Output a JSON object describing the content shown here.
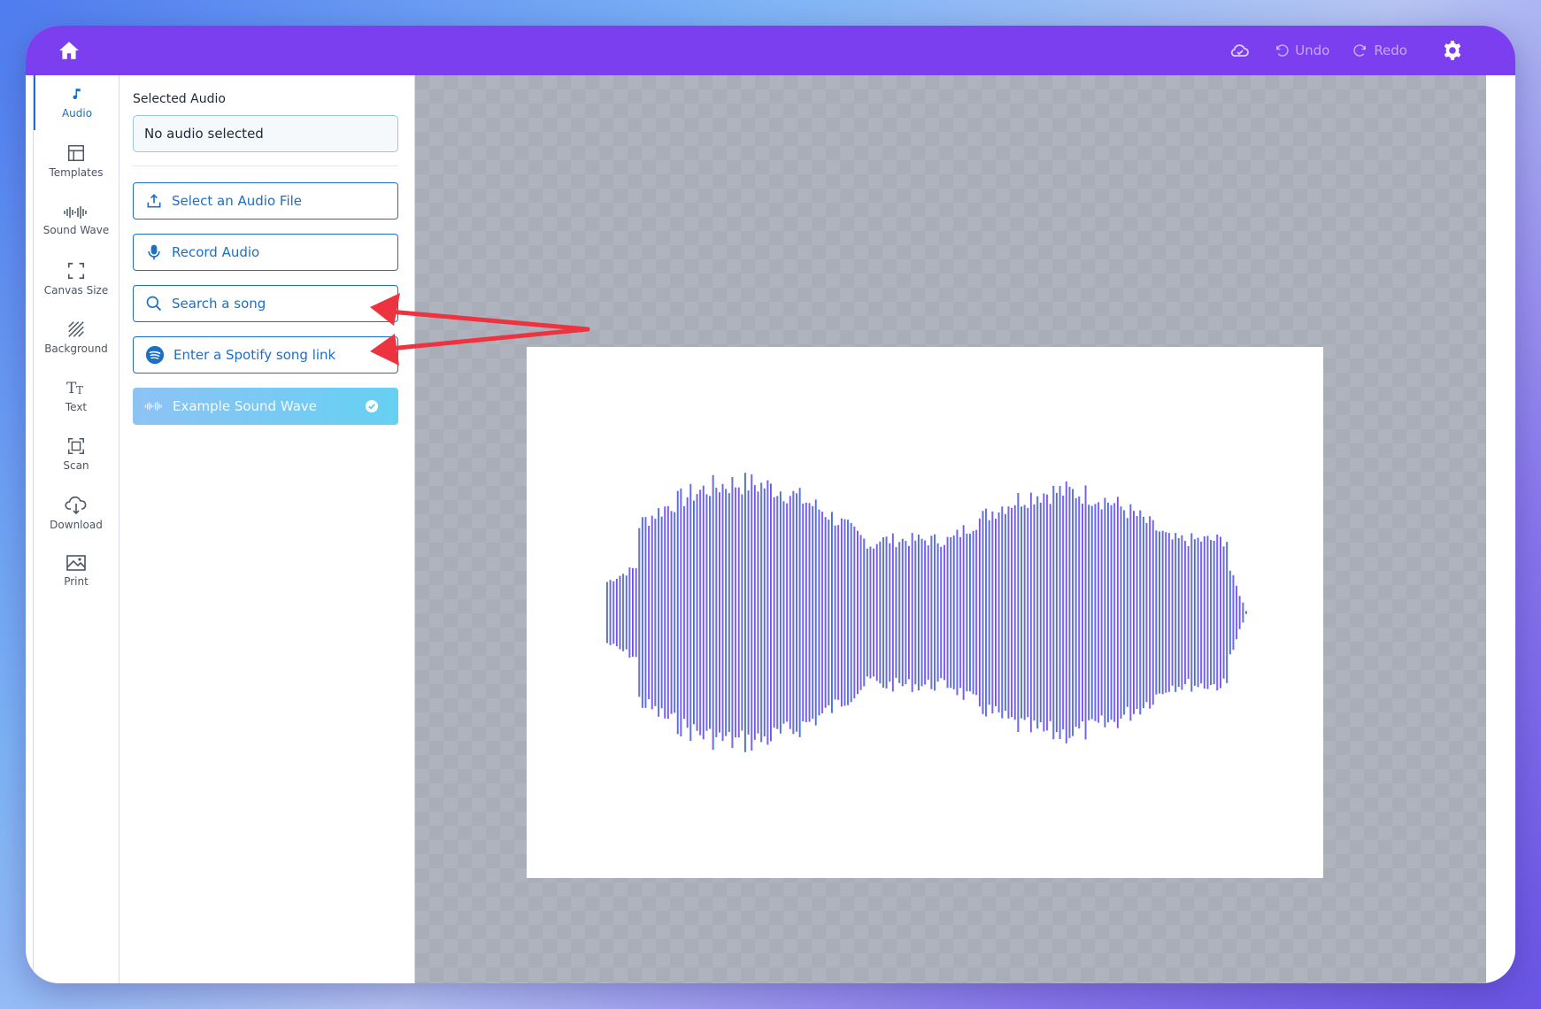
{
  "topbar": {
    "undo_label": "Undo",
    "redo_label": "Redo",
    "icons": [
      "home-icon",
      "cloud-saved-icon",
      "undo-icon",
      "redo-icon",
      "gear-icon"
    ],
    "background": "#7b3ff0"
  },
  "sidebar": {
    "items": [
      {
        "label": "Audio",
        "icon": "music-note-icon",
        "active": true
      },
      {
        "label": "Templates",
        "icon": "templates-icon"
      },
      {
        "label": "Sound Wave",
        "icon": "sound-wave-icon"
      },
      {
        "label": "Canvas Size",
        "icon": "canvas-size-icon"
      },
      {
        "label": "Background",
        "icon": "background-icon"
      },
      {
        "label": "Text",
        "icon": "text-icon"
      },
      {
        "label": "Scan",
        "icon": "scan-icon"
      },
      {
        "label": "Download",
        "icon": "download-icon"
      },
      {
        "label": "Print",
        "icon": "print-icon"
      }
    ],
    "active_color": "#1d6fc4"
  },
  "panel": {
    "selected_label": "Selected Audio",
    "selected_value": "No audio selected",
    "buttons": [
      {
        "label": "Select an Audio File",
        "icon": "upload-icon"
      },
      {
        "label": "Record Audio",
        "icon": "microphone-icon"
      },
      {
        "label": "Search a song",
        "icon": "search-icon"
      },
      {
        "label": "Enter a Spotify song link",
        "icon": "spotify-icon"
      },
      {
        "label": "Example Sound Wave",
        "icon": "sound-wave-icon",
        "selected": true
      }
    ]
  },
  "canvas": {
    "artboard_background": "#ffffff",
    "waveform_gradient": [
      "#8a2be2",
      "#4fa8e8"
    ],
    "annotation_arrows": [
      "Search a song",
      "Enter a Spotify song link"
    ],
    "arrow_color": "#ee3340"
  }
}
